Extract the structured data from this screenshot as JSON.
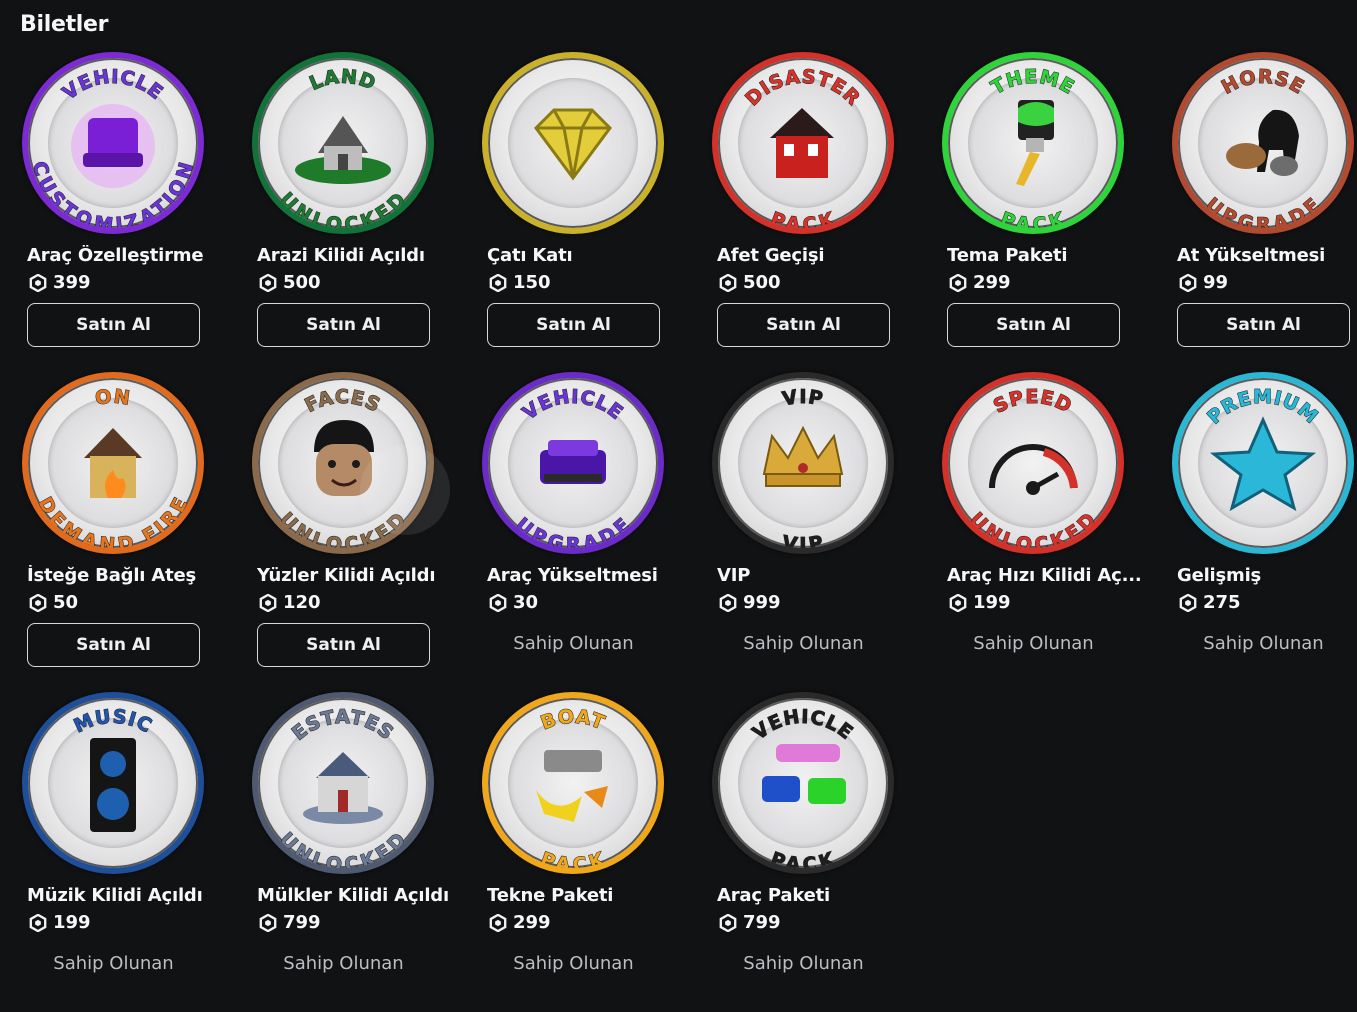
{
  "section_title": "Biletler",
  "items": [
    {
      "name": "Araç Özelleştirme",
      "price": "399",
      "status": "buy",
      "button_label": "Satın Al",
      "ring_color": "#7b2bd1",
      "top_text": "VEHICLE",
      "bottom_text": "CUSTOMIZATION",
      "text_color": "#6a35d6",
      "icon": "purple-car-icon"
    },
    {
      "name": "Arazi Kilidi Açıldı",
      "price": "500",
      "status": "buy",
      "button_label": "Satın Al",
      "ring_color": "#12723a",
      "top_text": "LAND",
      "bottom_text": "UNLOCKED",
      "text_color": "#1f7a34",
      "icon": "house-on-island-icon"
    },
    {
      "name": "Çatı Katı",
      "price": "150",
      "status": "buy",
      "button_label": "Satın Al",
      "ring_color": "#c9b22a",
      "top_text": "",
      "bottom_text": "",
      "text_color": "#d9c12b",
      "icon": "diamond-icon"
    },
    {
      "name": "Afet Geçişi",
      "price": "500",
      "status": "buy",
      "button_label": "Satın Al",
      "ring_color": "#d3322b",
      "top_text": "DISASTER",
      "bottom_text": "PACK",
      "text_color": "#d8322a",
      "icon": "red-house-icon"
    },
    {
      "name": "Tema Paketi",
      "price": "299",
      "status": "buy",
      "button_label": "Satın Al",
      "ring_color": "#2fd33a",
      "top_text": "THEME",
      "bottom_text": "PACK",
      "text_color": "#2fd33a",
      "icon": "paint-brush-icon"
    },
    {
      "name": "At Yükseltmesi",
      "price": "99",
      "status": "buy",
      "button_label": "Satın Al",
      "ring_color": "#b04a30",
      "top_text": "HORSE",
      "bottom_text": "UPGRADE",
      "text_color": "#b54a2e",
      "icon": "horses-icon"
    },
    {
      "name": "İsteğe Bağlı Ateş",
      "price": "50",
      "status": "buy",
      "button_label": "Satın Al",
      "ring_color": "#e06a1e",
      "top_text": "ON",
      "bottom_text": "DEMAND FIRE",
      "text_color": "#e5761e",
      "icon": "burning-house-icon"
    },
    {
      "name": "Yüzler Kilidi Açıldı",
      "price": "120",
      "status": "buy",
      "button_label": "Satın Al",
      "ring_color": "#8a6a4a",
      "top_text": "FACES",
      "bottom_text": "UNLOCKED",
      "text_color": "#8a6b4c",
      "icon": "avatar-face-icon"
    },
    {
      "name": "Araç Yükseltmesi",
      "price": "30",
      "status": "owned",
      "owned_label": "Sahip Olunan",
      "ring_color": "#6b2bc6",
      "top_text": "VEHICLE",
      "bottom_text": "UPGRADE",
      "text_color": "#6a35d6",
      "icon": "purple-car-front-icon"
    },
    {
      "name": "VIP",
      "price": "999",
      "status": "owned",
      "owned_label": "Sahip Olunan",
      "ring_color": "#2a2a2a",
      "top_text": "VIP",
      "bottom_text": "VIP",
      "text_color": "#1e1e1e",
      "icon": "crown-icon"
    },
    {
      "name": "Araç Hızı Kilidi Aç...",
      "price": "199",
      "status": "owned",
      "owned_label": "Sahip Olunan",
      "ring_color": "#d3322b",
      "top_text": "SPEED",
      "bottom_text": "UNLOCKED",
      "text_color": "#d8322a",
      "icon": "speedometer-icon"
    },
    {
      "name": "Gelişmiş",
      "price": "275",
      "status": "owned",
      "owned_label": "Sahip Olunan",
      "ring_color": "#2bb7d3",
      "top_text": "PREMIUM",
      "bottom_text": "",
      "text_color": "#25b8d8",
      "icon": "star-icon"
    },
    {
      "name": "Müzik Kilidi Açıldı",
      "price": "199",
      "status": "owned",
      "owned_label": "Sahip Olunan",
      "ring_color": "#1f4f99",
      "top_text": "MUSIC",
      "bottom_text": "",
      "text_color": "#2355b0",
      "icon": "speaker-icon"
    },
    {
      "name": "Mülkler Kilidi Açıldı",
      "price": "799",
      "status": "owned",
      "owned_label": "Sahip Olunan",
      "ring_color": "#4f5a70",
      "top_text": "ESTATES",
      "bottom_text": "UNLOCKED",
      "text_color": "#6d7a95",
      "icon": "mansion-icon"
    },
    {
      "name": "Tekne Paketi",
      "price": "299",
      "status": "owned",
      "owned_label": "Sahip Olunan",
      "ring_color": "#f0a81a",
      "top_text": "BOAT",
      "bottom_text": "PACK",
      "text_color": "#f0a81a",
      "icon": "boats-icon"
    },
    {
      "name": "Araç Paketi",
      "price": "799",
      "status": "owned",
      "owned_label": "Sahip Olunan",
      "ring_color": "#2a2a2a",
      "top_text": "VEHICLE",
      "bottom_text": "PACK",
      "text_color": "#1e1e1e",
      "icon": "cars-icon"
    }
  ]
}
